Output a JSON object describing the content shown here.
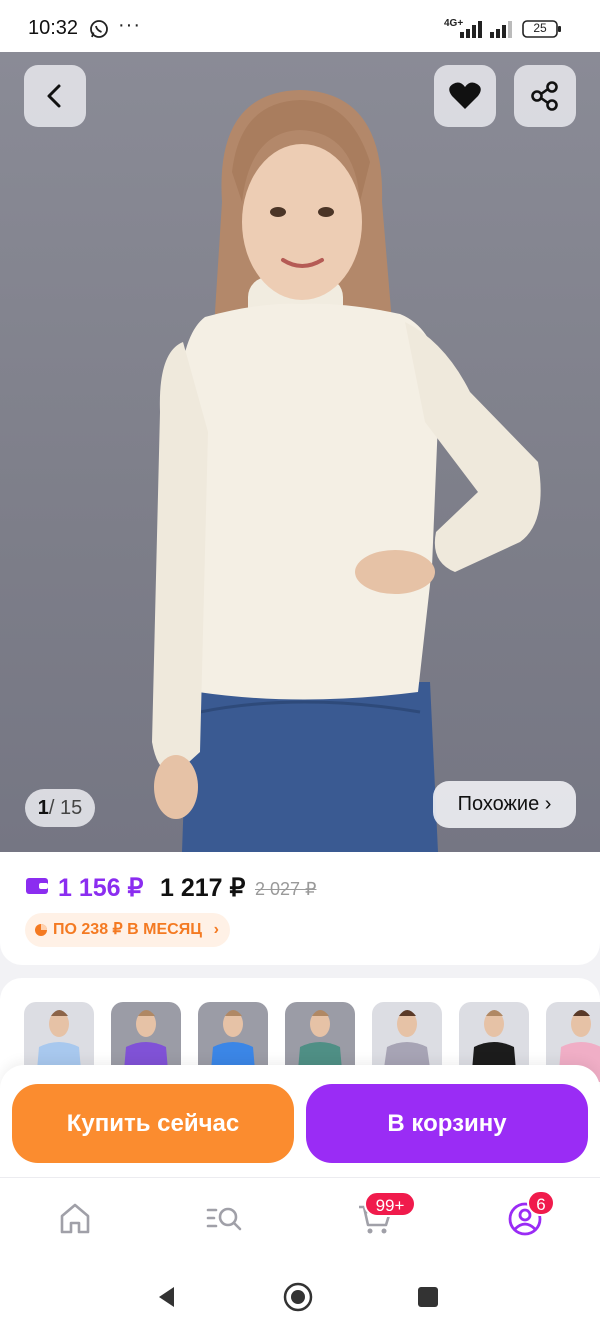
{
  "status_bar": {
    "time": "10:32",
    "net_label": "4G+",
    "battery": "25",
    "icons": [
      "whatsapp-icon",
      "more-dots-icon",
      "signal-icon",
      "battery-icon"
    ]
  },
  "gallery": {
    "current": "1",
    "separator": "/",
    "total": "15",
    "similar_label": "Похожие ›",
    "icons": [
      "back-arrow-icon",
      "heart-icon",
      "share-icon"
    ]
  },
  "price": {
    "card_price": "1 156 ₽",
    "price": "1 217 ₽",
    "old_price": "2 027 ₽",
    "installment": "ПО 238 ₽ В МЕСЯЦ",
    "accent_color": "#8b2df0",
    "installment_color": "#f47a22"
  },
  "variants": {
    "colors": [
      "#a8c8ee",
      "#8052d6",
      "#3b86e6",
      "#4f8f85",
      "#a7a4b5",
      "#1c1c1c",
      "#f0aec6"
    ]
  },
  "actions": {
    "buy_now": "Купить сейчас",
    "add_to_cart": "В корзину",
    "buy_color": "#fb8c2f",
    "cart_color": "#9a2cf5"
  },
  "bottom_nav": {
    "cart_badge": "99+",
    "profile_badge": "6",
    "icons": [
      "home-icon",
      "catalog-search-icon",
      "cart-icon",
      "profile-icon"
    ]
  }
}
